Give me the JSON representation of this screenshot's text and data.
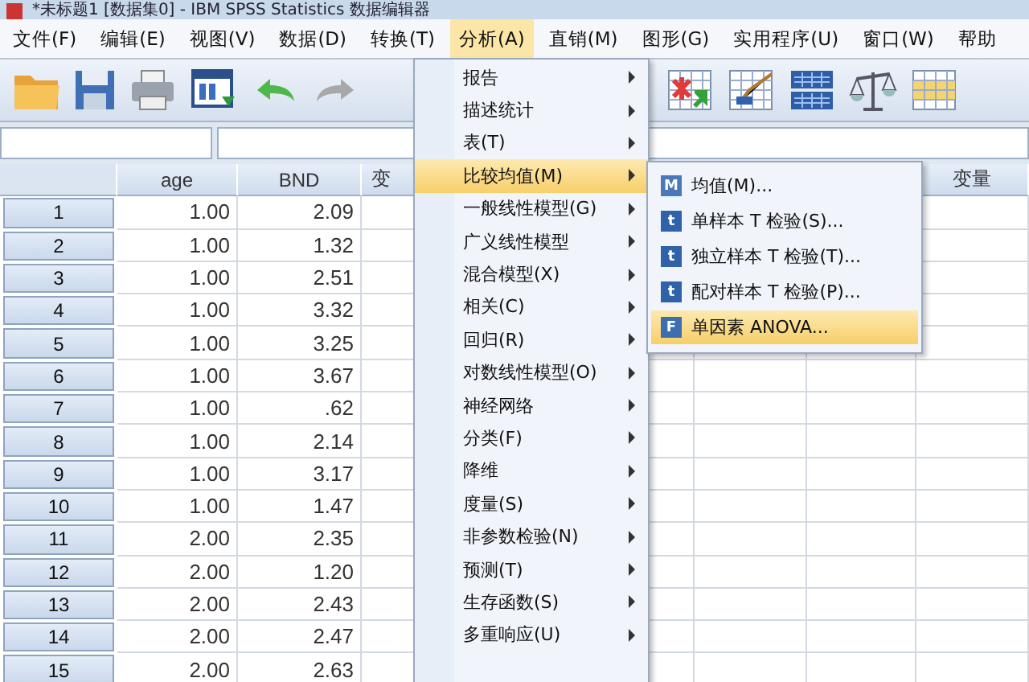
{
  "window": {
    "title": "*未标题1 [数据集0] - IBM SPSS Statistics 数据编辑器"
  },
  "menubar": [
    {
      "label": "文件(F)",
      "selected": false
    },
    {
      "label": "编辑(E)",
      "selected": false
    },
    {
      "label": "视图(V)",
      "selected": false
    },
    {
      "label": "数据(D)",
      "selected": false
    },
    {
      "label": "转换(T)",
      "selected": false
    },
    {
      "label": "分析(A)",
      "selected": true
    },
    {
      "label": "直销(M)",
      "selected": false
    },
    {
      "label": "图形(G)",
      "selected": false
    },
    {
      "label": "实用程序(U)",
      "selected": false
    },
    {
      "label": "窗口(W)",
      "selected": false
    },
    {
      "label": "帮助",
      "selected": false
    }
  ],
  "table": {
    "columns": [
      {
        "label": "age"
      },
      {
        "label": "BND"
      },
      {
        "label": "变"
      },
      {
        "label": "变量"
      }
    ],
    "rows": [
      {
        "number": "1",
        "age": "1.00",
        "bnd": "2.09"
      },
      {
        "number": "2",
        "age": "1.00",
        "bnd": "1.32"
      },
      {
        "number": "3",
        "age": "1.00",
        "bnd": "2.51"
      },
      {
        "number": "4",
        "age": "1.00",
        "bnd": "3.32"
      },
      {
        "number": "5",
        "age": "1.00",
        "bnd": "3.25"
      },
      {
        "number": "6",
        "age": "1.00",
        "bnd": "3.67"
      },
      {
        "number": "7",
        "age": "1.00",
        "bnd": ".62"
      },
      {
        "number": "8",
        "age": "1.00",
        "bnd": "2.14"
      },
      {
        "number": "9",
        "age": "1.00",
        "bnd": "3.17"
      },
      {
        "number": "10",
        "age": "1.00",
        "bnd": "1.47"
      },
      {
        "number": "11",
        "age": "2.00",
        "bnd": "2.35"
      },
      {
        "number": "12",
        "age": "2.00",
        "bnd": "1.20"
      },
      {
        "number": "13",
        "age": "2.00",
        "bnd": "2.43"
      },
      {
        "number": "14",
        "age": "2.00",
        "bnd": "2.47"
      },
      {
        "number": "15",
        "age": "2.00",
        "bnd": "2.63"
      }
    ]
  },
  "analyze_menu": {
    "items": [
      {
        "label": "报告",
        "selected": false
      },
      {
        "label": "描述统计",
        "selected": false
      },
      {
        "label": "表(T)",
        "selected": false
      },
      {
        "label": "比较均值(M)",
        "selected": true
      },
      {
        "label": "一般线性模型(G)",
        "selected": false
      },
      {
        "label": "广义线性模型",
        "selected": false
      },
      {
        "label": "混合模型(X)",
        "selected": false
      },
      {
        "label": "相关(C)",
        "selected": false
      },
      {
        "label": "回归(R)",
        "selected": false
      },
      {
        "label": "对数线性模型(O)",
        "selected": false
      },
      {
        "label": "神经网络",
        "selected": false
      },
      {
        "label": "分类(F)",
        "selected": false
      },
      {
        "label": "降维",
        "selected": false
      },
      {
        "label": "度量(S)",
        "selected": false
      },
      {
        "label": "非参数检验(N)",
        "selected": false
      },
      {
        "label": "预测(T)",
        "selected": false
      },
      {
        "label": "生存函数(S)",
        "selected": false
      },
      {
        "label": "多重响应(U)",
        "selected": false
      }
    ]
  },
  "compare_means_submenu": {
    "items": [
      {
        "label": "均值(M)...",
        "selected": false,
        "icon": "M"
      },
      {
        "label": "单样本 T 检验(S)...",
        "selected": false,
        "icon": "t"
      },
      {
        "label": "独立样本 T 检验(T)...",
        "selected": false,
        "icon": "t"
      },
      {
        "label": "配对样本 T 检验(P)...",
        "selected": false,
        "icon": "t"
      },
      {
        "label": "单因素 ANOVA...",
        "selected": true,
        "icon": "F"
      }
    ]
  }
}
